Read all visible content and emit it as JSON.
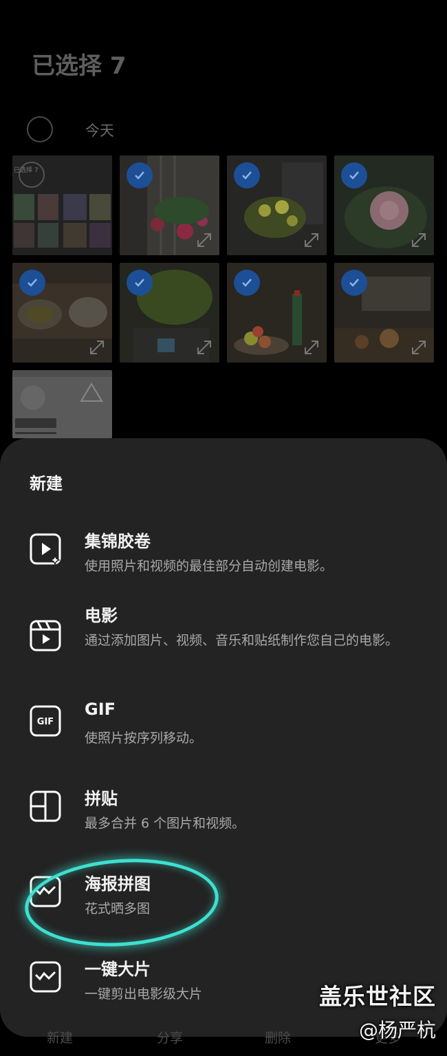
{
  "header": {
    "title": "已选择 7"
  },
  "gallery": {
    "date_label": "今天",
    "thumb_overlay_text": "已选择 7"
  },
  "sheet": {
    "title": "新建",
    "options": [
      {
        "title": "集锦胶卷",
        "desc": "使用照片和视频的最佳部分自动创建电影。",
        "icon": "highlight-reel-icon"
      },
      {
        "title": "电影",
        "desc": "通过添加图片、视频、音乐和贴纸制作您自己的电影。",
        "icon": "clapperboard-icon"
      },
      {
        "title": "GIF",
        "desc": "使照片按序列移动。",
        "icon": "gif-icon",
        "icon_text": "GIF"
      },
      {
        "title": "拼贴",
        "desc": "最多合并 6 个图片和视频。",
        "icon": "collage-icon"
      },
      {
        "title": "海报拼图",
        "desc": "花式晒多图",
        "icon": "poster-icon"
      },
      {
        "title": "一键大片",
        "desc": "一键剪出电影级大片",
        "icon": "blockbuster-icon"
      }
    ]
  },
  "bottom_nav": [
    "新建",
    "分享",
    "删除",
    "更多"
  ],
  "watermark": {
    "brand": "盖乐世社区",
    "author": "@杨严杭"
  },
  "colors": {
    "accent": "#1d4f96",
    "highlight": "#3ee0d0",
    "sheet_bg": "#232323"
  }
}
